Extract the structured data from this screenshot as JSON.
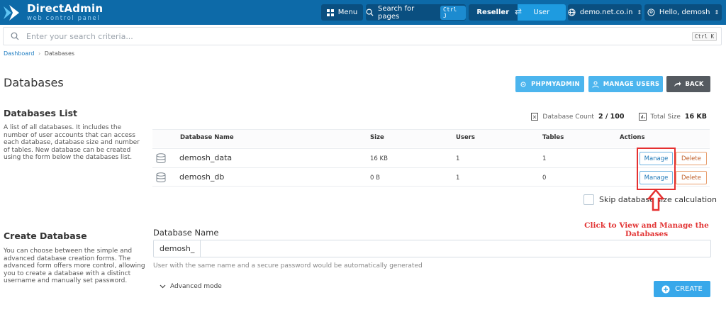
{
  "topbar": {
    "logo_title": "DirectAdmin",
    "logo_subtitle": "web control panel",
    "menu_label": "Menu",
    "search_pages_label": "Search for pages",
    "search_pages_shortcut": "Ctrl J",
    "reseller_label": "Reseller",
    "user_label": "User",
    "domain_label": "demo.net.co.in",
    "greeting_label": "Hello, demosh",
    "brand_color": "#0d6aa8"
  },
  "search": {
    "placeholder": "Enter your search criteria...",
    "shortcut": "Ctrl K"
  },
  "breadcrumb": {
    "home": "Dashboard",
    "separator": "›",
    "current": "Databases"
  },
  "page": {
    "title": "Databases",
    "actions": {
      "phpmyadmin": "PHPMYADMIN",
      "manage_users": "MANAGE USERS",
      "back": "BACK"
    }
  },
  "databases_list": {
    "title": "Databases List",
    "description": "A list of all databases. It includes the number of user accounts that can access each database, database size and number of tables. New database can be created using the form below the databases list.",
    "count_label": "Database Count",
    "count_value": "2 / 100",
    "total_size_label": "Total Size",
    "total_size_value": "16 KB",
    "columns": [
      "Database Name",
      "Size",
      "Users",
      "Tables",
      "Actions"
    ],
    "rows": [
      {
        "name": "demosh_data",
        "size": "16 KB",
        "users": "1",
        "tables": "1"
      },
      {
        "name": "demosh_db",
        "size": "0 B",
        "users": "1",
        "tables": "0"
      }
    ],
    "manage_label": "Manage",
    "delete_label": "Delete",
    "skip_label": "Skip database size calculation"
  },
  "annotation": {
    "text": "Click to View and Manage the Databases",
    "color": "#e53030"
  },
  "create_database": {
    "title": "Create Database",
    "description": "You can choose between the simple and advanced database creation forms. The advanced form offers more control, allowing you to create a database with a distinct username and manually set password.",
    "field_label": "Database Name",
    "prefix": "demosh_",
    "input_value": "",
    "hint": "User with the same name and a secure password would be automatically generated",
    "advanced_label": "Advanced mode",
    "create_label": "CREATE"
  }
}
